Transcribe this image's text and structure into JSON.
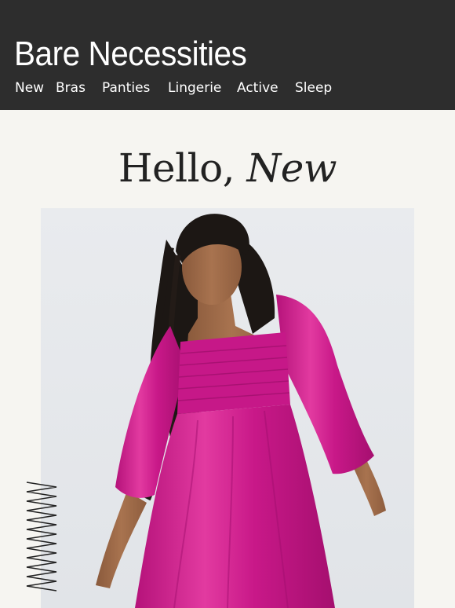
{
  "header": {
    "brand": "Bare Necessities",
    "nav": [
      {
        "label": "New"
      },
      {
        "label": "Bras"
      },
      {
        "label": "Panties"
      },
      {
        "label": "Lingerie"
      },
      {
        "label": "Active"
      },
      {
        "label": "Sleep"
      }
    ]
  },
  "hero": {
    "title_roman": "Hello, ",
    "title_italic": "New"
  },
  "colors": {
    "header_bg": "#2d2d2d",
    "page_bg": "#f6f5f1",
    "dress": "#d1208e",
    "photo_bg": "#e6e8eb"
  },
  "icons": {
    "decoration": "zigzag-line"
  }
}
